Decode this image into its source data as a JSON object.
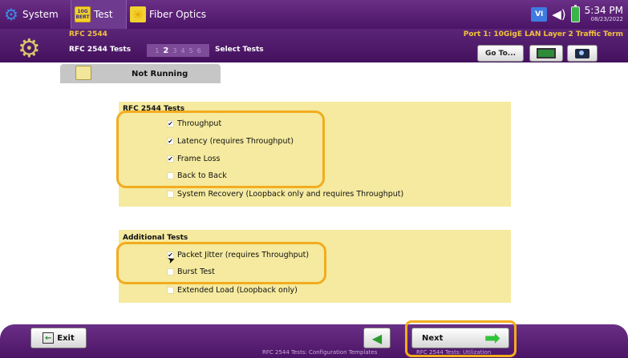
{
  "topbar": {
    "tabs": [
      {
        "label": "System",
        "icon": "gear-icon"
      },
      {
        "label": "Test",
        "icon": "bert-icon",
        "icon_text": "10G BERT"
      },
      {
        "label": "Fiber Optics",
        "icon": "fiber-icon"
      }
    ],
    "status_icons": [
      "vi-icon",
      "speaker-icon",
      "battery-icon"
    ],
    "vi_label": "VI",
    "time": "5:34 PM",
    "date": "08/23/2022"
  },
  "header": {
    "title": "RFC 2544",
    "port": "Port 1: 10GigE LAN Layer 2 Traffic Term",
    "subtitle": "RFC 2544 Tests",
    "steps": [
      "1",
      "2",
      "3",
      "4",
      "5",
      "6"
    ],
    "active_step": "2",
    "select_label": "Select Tests",
    "goto_label": "Go To..."
  },
  "status": {
    "text": "Not Running",
    "swatch_color": "#f2e69a"
  },
  "rfc_tests": {
    "title": "RFC 2544 Tests",
    "options": [
      {
        "label": "Throughput",
        "checked": true
      },
      {
        "label": "Latency (requires Throughput)",
        "checked": true
      },
      {
        "label": "Frame Loss",
        "checked": true
      },
      {
        "label": "Back to Back",
        "checked": false
      },
      {
        "label": "System Recovery (Loopback only and requires Throughput)",
        "checked": false
      }
    ]
  },
  "additional_tests": {
    "title": "Additional Tests",
    "options": [
      {
        "label": "Packet Jitter (requires Throughput)",
        "checked": true
      },
      {
        "label": "Burst Test",
        "checked": false
      },
      {
        "label": "Extended Load (Loopback only)",
        "checked": false
      }
    ]
  },
  "footer": {
    "exit_label": "Exit",
    "next_label": "Next",
    "back_caption": "RFC 2544 Tests: Configuration Templates",
    "next_caption": "RFC 2544 Tests: Utilization"
  },
  "colors": {
    "accent_purple": "#5b2577",
    "panel_yellow": "#f5ea9f",
    "highlight_orange": "#f2ac1f",
    "title_gold": "#f2c23a"
  }
}
